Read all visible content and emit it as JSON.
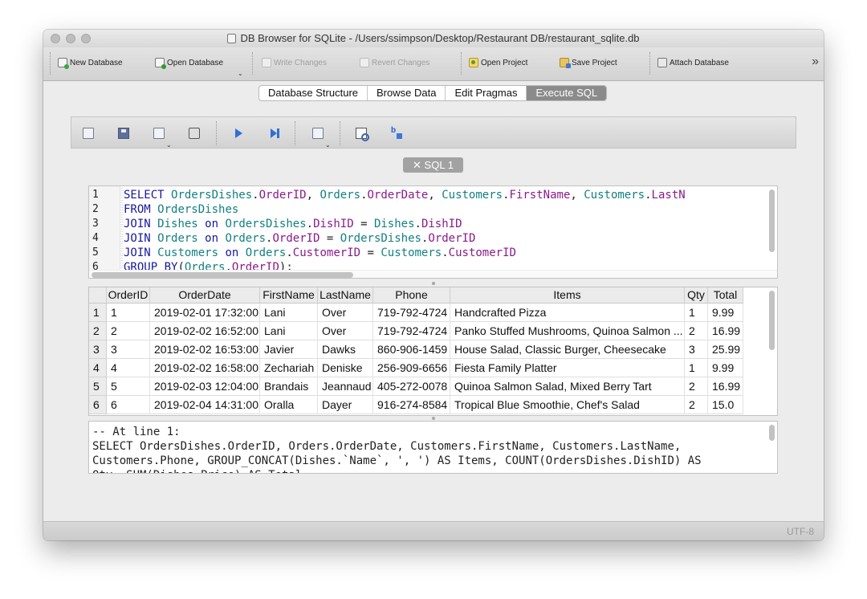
{
  "window": {
    "title": "DB Browser for SQLite - /Users/ssimpson/Desktop/Restaurant DB/restaurant_sqlite.db"
  },
  "toolbar": {
    "new_database": "New Database",
    "open_database": "Open Database",
    "write_changes": "Write Changes",
    "revert_changes": "Revert Changes",
    "open_project": "Open Project",
    "save_project": "Save Project",
    "attach_database": "Attach Database",
    "more": "»"
  },
  "tabs": [
    "Database Structure",
    "Browse Data",
    "Edit Pragmas",
    "Execute SQL"
  ],
  "active_tab": "Execute SQL",
  "sql_tab": {
    "label": "✕ SQL 1"
  },
  "editor": {
    "lines": [
      {
        "num": "1",
        "tokens": [
          [
            "kw",
            "SELECT "
          ],
          [
            "tb",
            "OrdersDishes"
          ],
          [
            "pl",
            "."
          ],
          [
            "fn",
            "OrderID"
          ],
          [
            "pl",
            ", "
          ],
          [
            "tb",
            "Orders"
          ],
          [
            "pl",
            "."
          ],
          [
            "fn",
            "OrderDate"
          ],
          [
            "pl",
            ", "
          ],
          [
            "tb",
            "Customers"
          ],
          [
            "pl",
            "."
          ],
          [
            "fn",
            "FirstName"
          ],
          [
            "pl",
            ", "
          ],
          [
            "tb",
            "Customers"
          ],
          [
            "pl",
            "."
          ],
          [
            "fn",
            "LastN"
          ]
        ]
      },
      {
        "num": "2",
        "tokens": [
          [
            "kw",
            "FROM "
          ],
          [
            "tb",
            "OrdersDishes"
          ]
        ]
      },
      {
        "num": "3",
        "tokens": [
          [
            "kw",
            "JOIN "
          ],
          [
            "tb",
            "Dishes "
          ],
          [
            "kw",
            "on "
          ],
          [
            "tb",
            "OrdersDishes"
          ],
          [
            "pl",
            "."
          ],
          [
            "fn",
            "DishID"
          ],
          [
            "pl",
            " = "
          ],
          [
            "tb",
            "Dishes"
          ],
          [
            "pl",
            "."
          ],
          [
            "fn",
            "DishID"
          ]
        ]
      },
      {
        "num": "4",
        "tokens": [
          [
            "kw",
            "JOIN "
          ],
          [
            "tb",
            "Orders "
          ],
          [
            "kw",
            "on "
          ],
          [
            "tb",
            "Orders"
          ],
          [
            "pl",
            "."
          ],
          [
            "fn",
            "OrderID"
          ],
          [
            "pl",
            " = "
          ],
          [
            "tb",
            "OrdersDishes"
          ],
          [
            "pl",
            "."
          ],
          [
            "fn",
            "OrderID"
          ]
        ]
      },
      {
        "num": "5",
        "tokens": [
          [
            "kw",
            "JOIN "
          ],
          [
            "tb",
            "Customers "
          ],
          [
            "kw",
            "on "
          ],
          [
            "tb",
            "Orders"
          ],
          [
            "pl",
            "."
          ],
          [
            "fn",
            "CustomerID"
          ],
          [
            "pl",
            " = "
          ],
          [
            "tb",
            "Customers"
          ],
          [
            "pl",
            "."
          ],
          [
            "fn",
            "CustomerID"
          ]
        ]
      },
      {
        "num": "6",
        "tokens": [
          [
            "kw",
            "GROUP BY"
          ],
          [
            "pl",
            "("
          ],
          [
            "tb",
            "Orders"
          ],
          [
            "pl",
            "."
          ],
          [
            "fn",
            "OrderID"
          ],
          [
            "pl",
            ");"
          ]
        ]
      }
    ]
  },
  "results": {
    "columns": [
      "OrderID",
      "OrderDate",
      "FirstName",
      "LastName",
      "Phone",
      "Items",
      "Qty",
      "Total"
    ],
    "rows": [
      [
        "1",
        "2019-02-01 17:32:00",
        "Lani",
        "Over",
        "719-792-4724",
        "Handcrafted Pizza",
        "1",
        "9.99"
      ],
      [
        "2",
        "2019-02-02 16:52:00",
        "Lani",
        "Over",
        "719-792-4724",
        "Panko Stuffed Mushrooms, Quinoa Salmon ...",
        "2",
        "16.99"
      ],
      [
        "3",
        "2019-02-02 16:53:00",
        "Javier",
        "Dawks",
        "860-906-1459",
        "House Salad, Classic Burger, Cheesecake",
        "3",
        "25.99"
      ],
      [
        "4",
        "2019-02-02 16:58:00",
        "Zechariah",
        "Deniske",
        "256-909-6656",
        "Fiesta Family Platter",
        "1",
        "9.99"
      ],
      [
        "5",
        "2019-02-03 12:04:00",
        "Brandais",
        "Jeannaud",
        "405-272-0078",
        "Quinoa Salmon Salad, Mixed Berry Tart",
        "2",
        "16.99"
      ],
      [
        "6",
        "2019-02-04 14:31:00",
        "Oralla",
        "Dayer",
        "916-274-8584",
        "Tropical Blue Smoothie, Chef's Salad",
        "2",
        "15.0"
      ]
    ]
  },
  "message": {
    "lines": [
      "-- At line 1:",
      "SELECT OrdersDishes.OrderID, Orders.OrderDate, Customers.FirstName, Customers.LastName,",
      "Customers.Phone, GROUP_CONCAT(Dishes.`Name`, ', ') AS Items, COUNT(OrdersDishes.DishID) AS",
      "Qty, SUM(Dishes.Price) AS Total"
    ]
  },
  "status": {
    "encoding": "UTF-8"
  }
}
